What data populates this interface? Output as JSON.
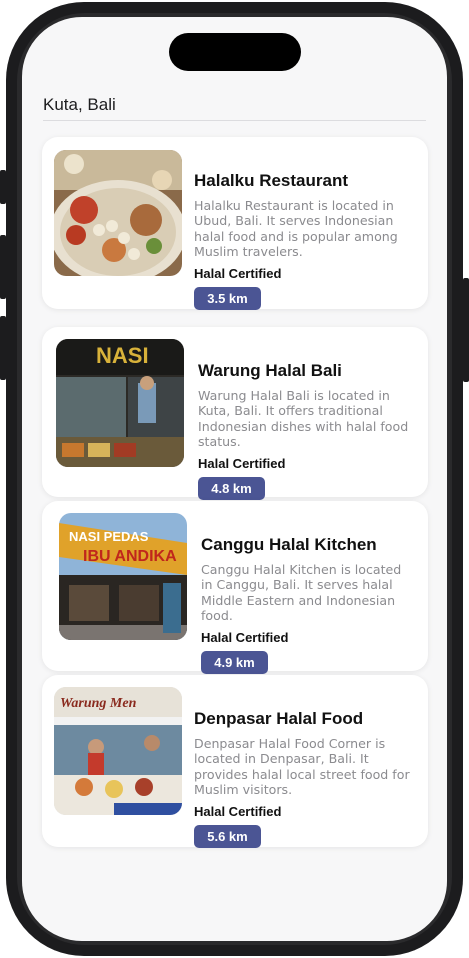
{
  "header": {
    "location": "Kuta, Bali"
  },
  "restaurants": [
    {
      "name": "Halalku Restaurant",
      "description": "Halalku Restaurant is located in Ubud, Bali. It serves Indonesian halal food and is popular among Muslim travelers.",
      "certification": "Halal Certified",
      "distance": "3.5 km"
    },
    {
      "name": "Warung Halal Bali",
      "description": "Warung Halal Bali is located in Kuta, Bali. It offers traditional Indonesian dishes with halal food status.",
      "certification": "Halal Certified",
      "distance": "4.8 km"
    },
    {
      "name": "Canggu Halal Kitchen",
      "description": "Canggu Halal Kitchen is located in Canggu, Bali. It serves halal Middle Eastern and Indonesian food.",
      "certification": "Halal Certified",
      "distance": "4.9 km"
    },
    {
      "name": "Denpasar Halal Food",
      "description": "Denpasar Halal Food Corner is located in Denpasar, Bali. It provides halal local street food for Muslim visitors.",
      "certification": "Halal Certified",
      "distance": "5.6 km"
    }
  ],
  "colors": {
    "accent": "#4b5594"
  }
}
